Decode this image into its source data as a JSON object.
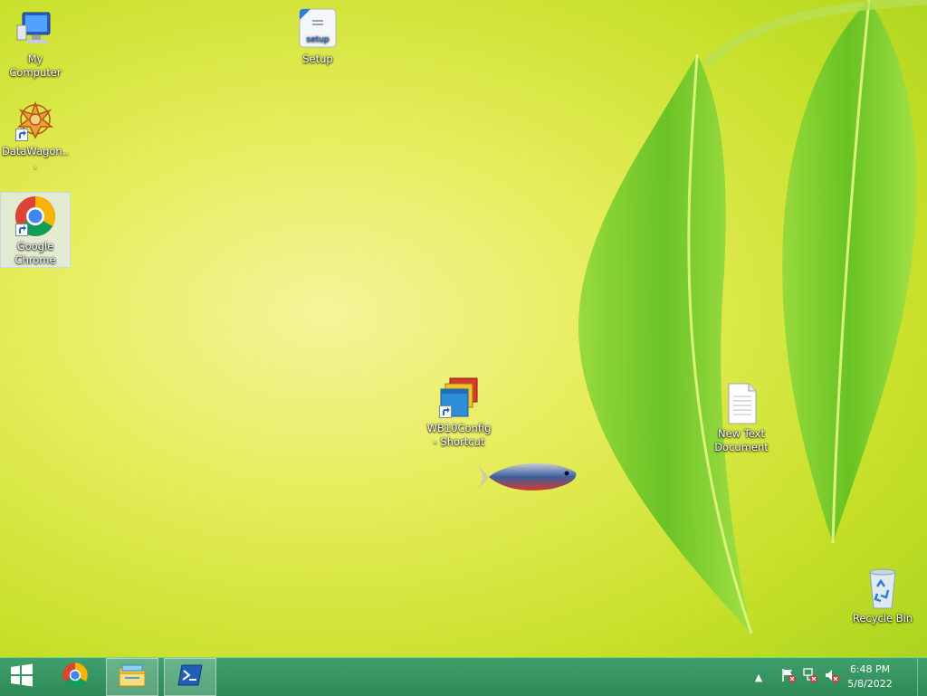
{
  "desktop": {
    "icons": [
      {
        "label": "My Computer",
        "icon": "my-computer-icon"
      },
      {
        "label": "DataWagon...",
        "icon": "datawagon-icon"
      },
      {
        "label": "Google Chrome",
        "icon": "chrome-icon"
      },
      {
        "label": "Setup",
        "icon": "setup-icon"
      },
      {
        "label": "WB10Config - Shortcut",
        "icon": "wb10config-icon"
      },
      {
        "label": "New Text Document",
        "icon": "text-document-icon"
      },
      {
        "label": "Recycle Bin",
        "icon": "recycle-bin-icon"
      }
    ],
    "selected_icon": "Google Chrome",
    "colors": {
      "wallpaper_light": "#f6f49a",
      "wallpaper_green": "#a6d21c",
      "leaf": "#6cc82a"
    }
  },
  "taskbar": {
    "start_icon": "windows-logo-icon",
    "pinned": [
      {
        "name": "Google Chrome",
        "icon": "chrome-icon"
      },
      {
        "name": "File Explorer",
        "icon": "file-explorer-icon"
      },
      {
        "name": "PowerShell",
        "icon": "powershell-icon"
      }
    ],
    "tray_icons": [
      "show-hidden-icons-chevron",
      "action-center-flag-icon",
      "network-error-icon",
      "volume-muted-icon"
    ],
    "clock": {
      "time": "6:48 PM",
      "date": "5/8/2022"
    },
    "color": "#2e8a58"
  }
}
